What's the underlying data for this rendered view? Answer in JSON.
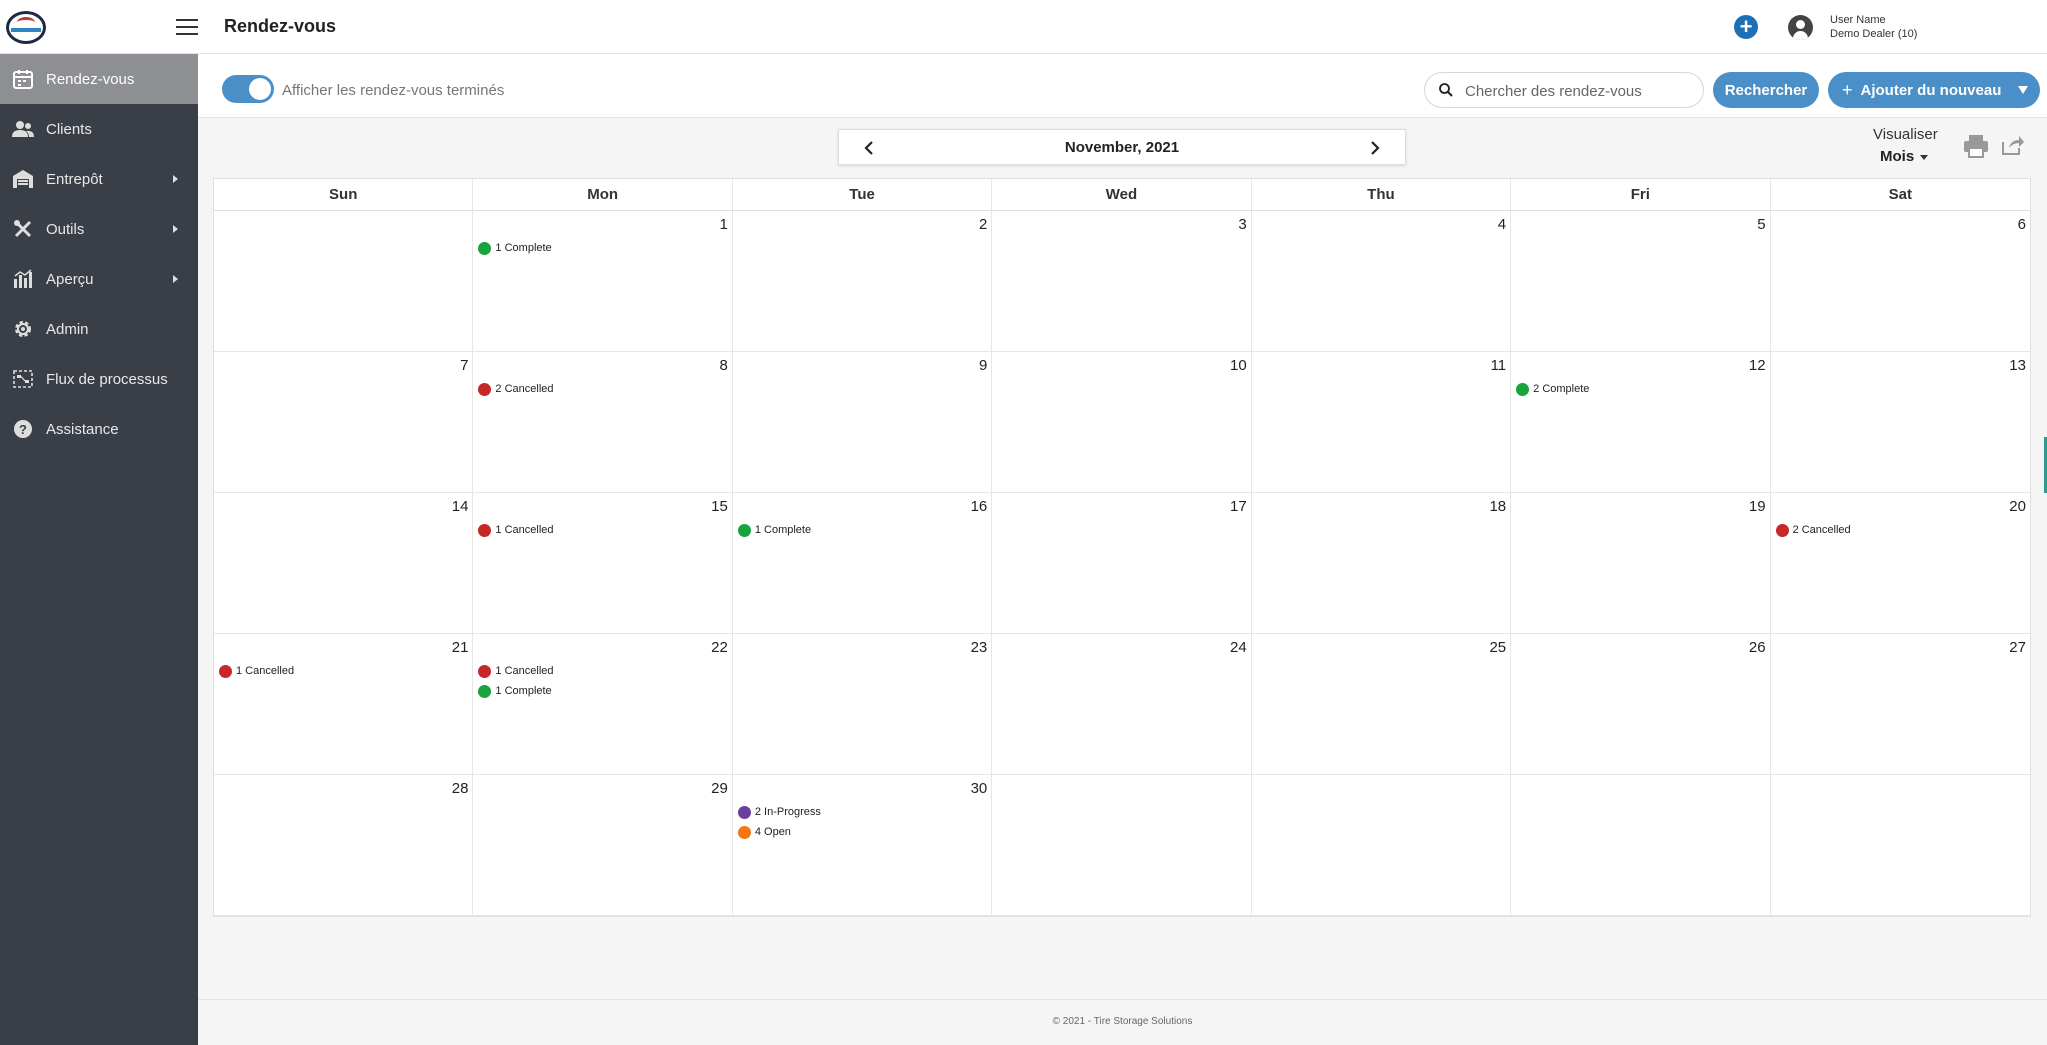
{
  "header": {
    "title": "Rendez-vous",
    "user_name": "User Name",
    "user_dealer": "Demo Dealer (10)"
  },
  "sidebar": {
    "items": [
      {
        "label": "Rendez-vous",
        "icon": "calendar-icon",
        "active": true
      },
      {
        "label": "Clients",
        "icon": "users-icon"
      },
      {
        "label": "Entrepôt",
        "icon": "warehouse-icon",
        "submenu": true
      },
      {
        "label": "Outils",
        "icon": "tools-icon",
        "submenu": true
      },
      {
        "label": "Aperçu",
        "icon": "chart-icon",
        "submenu": true
      },
      {
        "label": "Admin",
        "icon": "gear-icon"
      },
      {
        "label": "Flux de processus",
        "icon": "process-flow-icon"
      },
      {
        "label": "Assistance",
        "icon": "help-icon"
      }
    ]
  },
  "toolbar": {
    "toggle_label": "Afficher les rendez-vous terminés",
    "toggle_on": true,
    "search_placeholder": "Chercher des rendez-vous",
    "search_button": "Rechercher",
    "add_button": "Ajouter du nouveau"
  },
  "calendar": {
    "month_label": "November, 2021",
    "view_label": "Visualiser",
    "view_value": "Mois",
    "weekdays": [
      "Sun",
      "Mon",
      "Tue",
      "Wed",
      "Thu",
      "Fri",
      "Sat"
    ],
    "status_colors": {
      "Complete": "#1aa33c",
      "Cancelled": "#c62828",
      "In-Progress": "#6a3fa0",
      "Open": "#f07a11"
    },
    "weeks": [
      [
        {
          "day": "",
          "events": []
        },
        {
          "day": "1",
          "events": [
            {
              "count": "1",
              "status": "Complete",
              "text": "1 Complete"
            }
          ]
        },
        {
          "day": "2",
          "events": []
        },
        {
          "day": "3",
          "events": []
        },
        {
          "day": "4",
          "events": []
        },
        {
          "day": "5",
          "events": []
        },
        {
          "day": "6",
          "events": []
        }
      ],
      [
        {
          "day": "7",
          "events": []
        },
        {
          "day": "8",
          "events": [
            {
              "count": "2",
              "status": "Cancelled",
              "text": "2 Cancelled"
            }
          ]
        },
        {
          "day": "9",
          "events": []
        },
        {
          "day": "10",
          "events": []
        },
        {
          "day": "11",
          "events": []
        },
        {
          "day": "12",
          "events": [
            {
              "count": "2",
              "status": "Complete",
              "text": "2 Complete"
            }
          ]
        },
        {
          "day": "13",
          "events": []
        }
      ],
      [
        {
          "day": "14",
          "events": []
        },
        {
          "day": "15",
          "events": [
            {
              "count": "1",
              "status": "Cancelled",
              "text": "1 Cancelled"
            }
          ]
        },
        {
          "day": "16",
          "events": [
            {
              "count": "1",
              "status": "Complete",
              "text": "1 Complete"
            }
          ]
        },
        {
          "day": "17",
          "events": []
        },
        {
          "day": "18",
          "events": []
        },
        {
          "day": "19",
          "events": []
        },
        {
          "day": "20",
          "events": [
            {
              "count": "2",
              "status": "Cancelled",
              "text": "2 Cancelled"
            }
          ]
        }
      ],
      [
        {
          "day": "21",
          "events": [
            {
              "count": "1",
              "status": "Cancelled",
              "text": "1 Cancelled"
            }
          ]
        },
        {
          "day": "22",
          "events": [
            {
              "count": "1",
              "status": "Cancelled",
              "text": "1 Cancelled"
            },
            {
              "count": "1",
              "status": "Complete",
              "text": "1 Complete"
            }
          ]
        },
        {
          "day": "23",
          "events": []
        },
        {
          "day": "24",
          "events": []
        },
        {
          "day": "25",
          "events": []
        },
        {
          "day": "26",
          "events": []
        },
        {
          "day": "27",
          "events": []
        }
      ],
      [
        {
          "day": "28",
          "events": []
        },
        {
          "day": "29",
          "events": []
        },
        {
          "day": "30",
          "events": [
            {
              "count": "2",
              "status": "In-Progress",
              "text": "2 In-Progress"
            },
            {
              "count": "4",
              "status": "Open",
              "text": "4 Open"
            }
          ]
        },
        {
          "day": "",
          "events": []
        },
        {
          "day": "",
          "events": []
        },
        {
          "day": "",
          "events": []
        },
        {
          "day": "",
          "events": []
        }
      ]
    ]
  },
  "footer": {
    "text": "© 2021 - Tire Storage Solutions"
  },
  "colors": {
    "accent": "#4a8fc7",
    "sidebar_bg": "#3a3f47",
    "sidebar_active": "#8d8f93"
  }
}
